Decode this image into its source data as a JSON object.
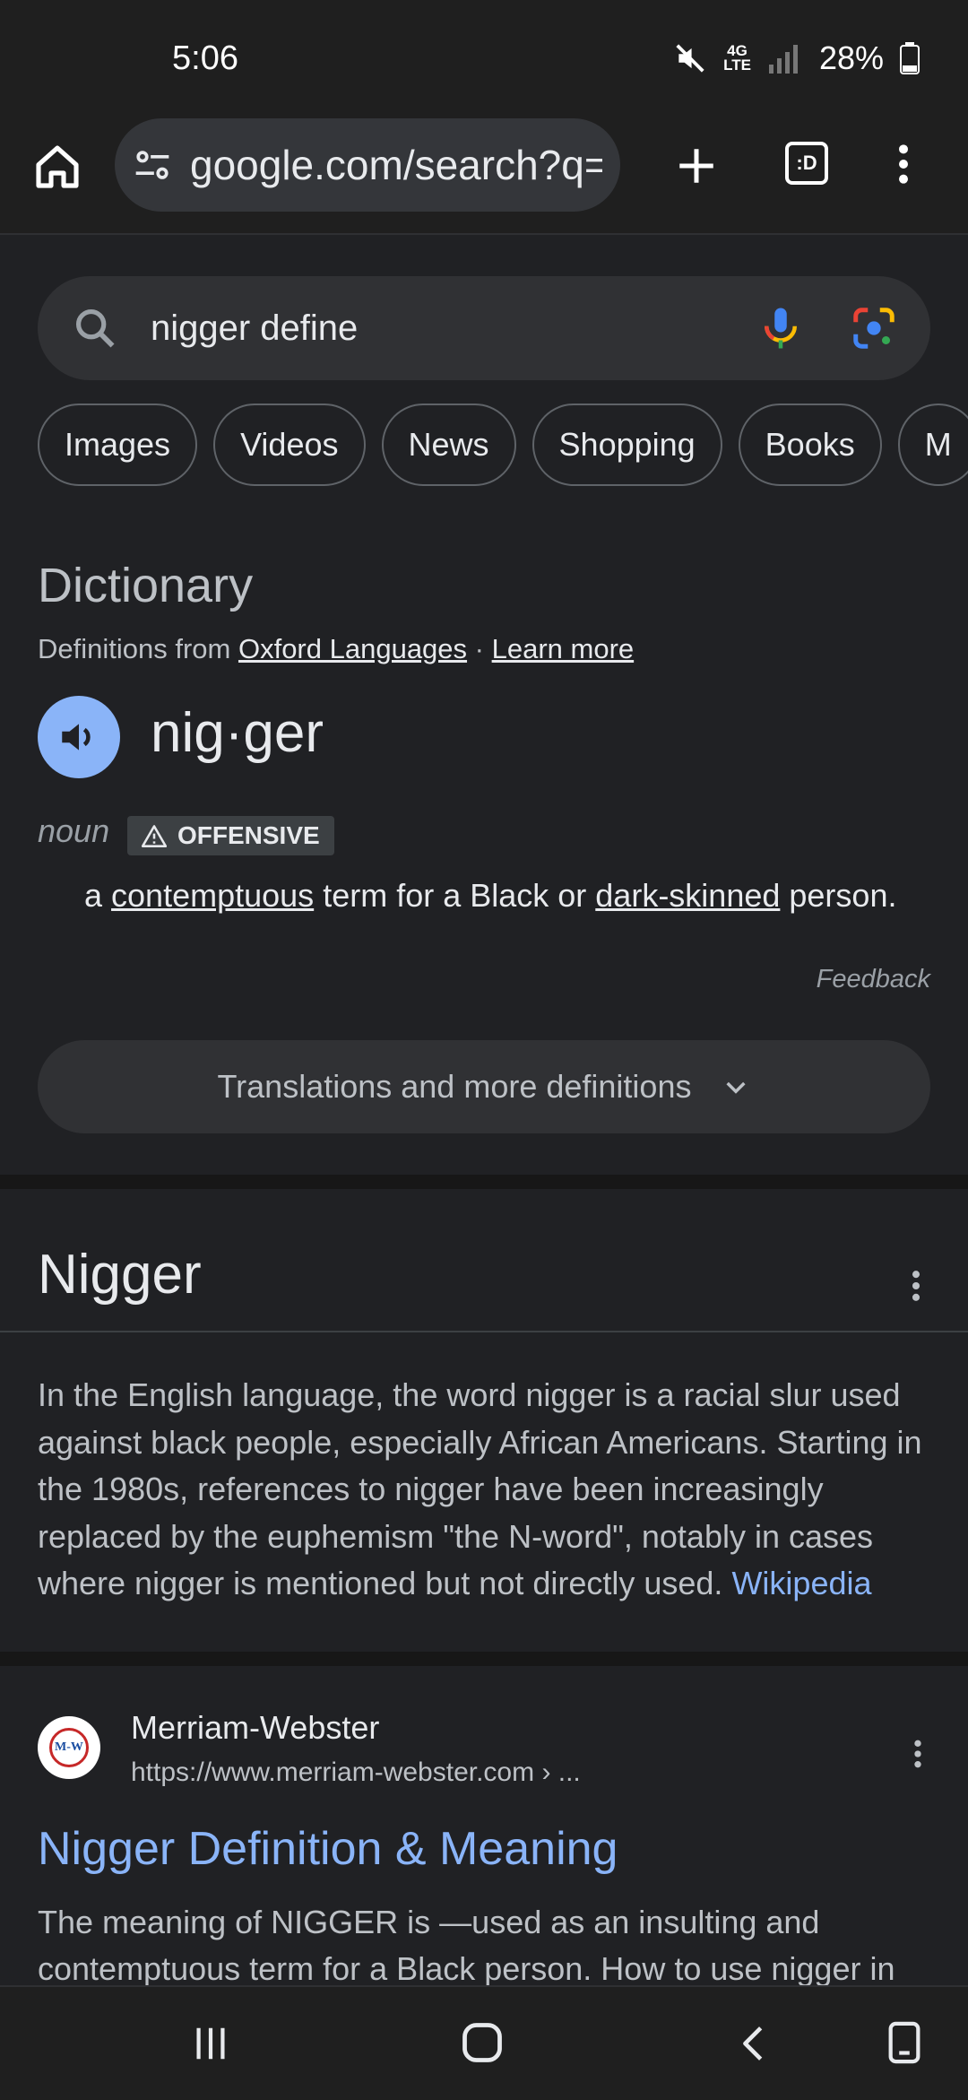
{
  "status": {
    "time": "5:06",
    "network": "4G LTE",
    "battery": "28%"
  },
  "browser": {
    "url": "google.com/search?q=",
    "tab_count": ":D"
  },
  "search": {
    "query": "nigger define"
  },
  "chips": [
    "Images",
    "Videos",
    "News",
    "Shopping",
    "Books",
    "M"
  ],
  "dictionary": {
    "heading": "Dictionary",
    "source_prefix": "Definitions from ",
    "source_link": "Oxford Languages",
    "separator": " · ",
    "learn_more": "Learn more",
    "headword": "nig·ger",
    "pos": "noun",
    "label": "OFFENSIVE",
    "def_a": "a ",
    "def_link1": "contemptuous",
    "def_mid": " term for a Black or ",
    "def_link2": "dark-skinned",
    "def_end": " person.",
    "feedback": "Feedback",
    "translations_button": "Translations and more definitions"
  },
  "knowledge_panel": {
    "title": "Nigger",
    "text": "In the English language, the word nigger is a racial slur used against black people, especially African Americans. Starting in the 1980s, references to nigger have been increasingly replaced by the euphemism \"the N-word\", notably in cases where nigger is mentioned but not directly used. ",
    "source": "Wikipedia"
  },
  "result": {
    "logo_text": "M-W",
    "site": "Merriam-Webster",
    "url": "https://www.merriam-webster.com › ...",
    "title": "Nigger Definition & Meaning",
    "snippet": "The meaning of NIGGER is —used as an insulting and contemptuous term for a Black person. How to use nigger in"
  },
  "colors": {
    "background": "#202124",
    "link": "#8ab4f8",
    "accent_speaker": "#8ab4f8"
  }
}
